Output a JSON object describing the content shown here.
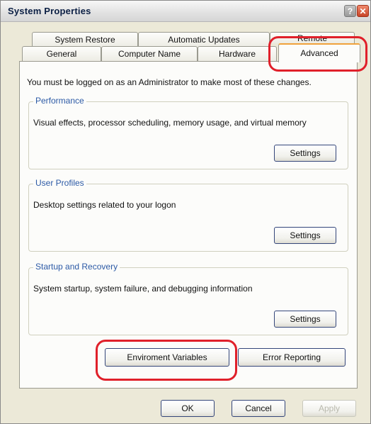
{
  "window": {
    "title": "System Properties",
    "help_glyph": "?",
    "close_glyph": "✕"
  },
  "tabs": {
    "row1": [
      "System Restore",
      "Automatic Updates",
      "Remote"
    ],
    "row2": [
      "General",
      "Computer Name",
      "Hardware",
      "Advanced"
    ],
    "active": "Advanced"
  },
  "panel": {
    "intro": "You must be logged on as an Administrator to make most of these changes.",
    "performance": {
      "label": "Performance",
      "description": "Visual effects, processor scheduling, memory usage, and virtual memory",
      "button": "Settings"
    },
    "user_profiles": {
      "label": "User Profiles",
      "description": "Desktop settings related to your logon",
      "button": "Settings"
    },
    "startup_recovery": {
      "label": "Startup and Recovery",
      "description": "System startup, system failure, and debugging information",
      "button": "Settings"
    },
    "env_button": "Enviroment Variables",
    "error_button": "Error Reporting"
  },
  "footer": {
    "ok": "OK",
    "cancel": "Cancel",
    "apply": "Apply"
  },
  "colors": {
    "highlight": "#e0202a",
    "active_tab_accent": "#f0a23c",
    "group_label": "#2c5aa6"
  }
}
